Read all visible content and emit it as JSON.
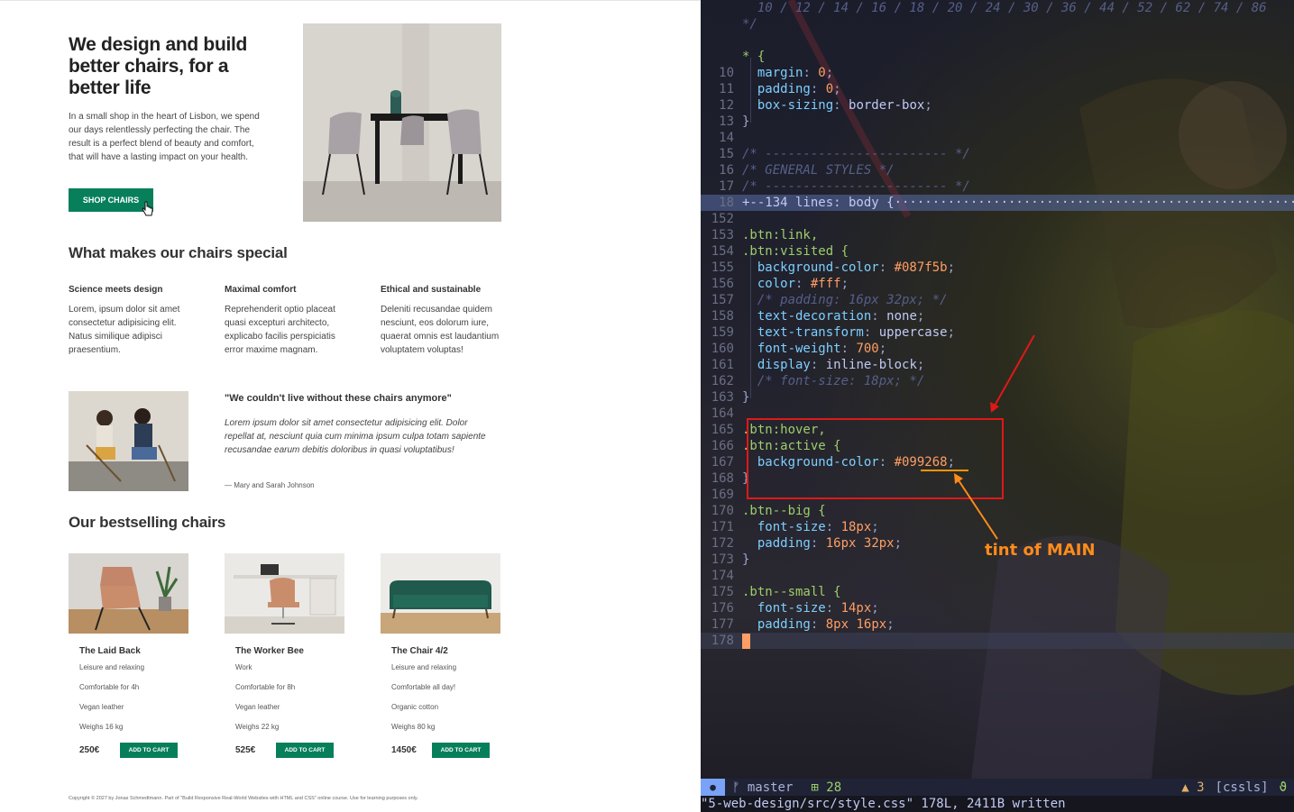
{
  "preview": {
    "hero": {
      "title": "We design and build better chairs, for a better life",
      "text": "In a small shop in the heart of Lisbon, we spend our days relentlessly perfecting the chair. The result is a perfect blend of beauty and comfort, that will have a lasting impact on your health.",
      "button_label": "SHOP CHAIRS"
    },
    "features": {
      "title": "What makes our chairs special",
      "items": [
        {
          "title": "Science meets design",
          "text": "Lorem, ipsum dolor sit amet consectetur adipisicing elit. Natus similique adipisci praesentium."
        },
        {
          "title": "Maximal comfort",
          "text": "Reprehenderit optio placeat quasi excepturi architecto, explicabo facilis perspiciatis error maxime magnam."
        },
        {
          "title": "Ethical and sustainable",
          "text": "Deleniti recusandae quidem nesciunt, eos dolorum iure, quaerat omnis est laudantium voluptatem voluptas!"
        }
      ]
    },
    "testimonial": {
      "quote_title": "\"We couldn't live without these chairs anymore\"",
      "text": "Lorem ipsum dolor sit amet consectetur adipisicing elit. Dolor repellat at, nesciunt quia cum minima ipsum culpa totam sapiente recusandae earum debitis doloribus in quasi voluptatibus!",
      "author": "— Mary and Sarah Johnson"
    },
    "products": {
      "title": "Our bestselling chairs",
      "cart_label": "ADD TO CART",
      "items": [
        {
          "name": "The Laid Back",
          "attrs": [
            "Leisure and relaxing",
            "Comfortable for 4h",
            "Vegan leather",
            "Weighs 16 kg"
          ],
          "price": "250€"
        },
        {
          "name": "The Worker Bee",
          "attrs": [
            "Work",
            "Comfortable for 8h",
            "Vegan leather",
            "Weighs 22 kg"
          ],
          "price": "525€"
        },
        {
          "name": "The Chair 4/2",
          "attrs": [
            "Leisure and relaxing",
            "Comfortable all day!",
            "Organic cotton",
            "Weighs 80 kg"
          ],
          "price": "1450€"
        }
      ]
    },
    "copyright": "Copyright © 2027 by Jonas Schmedtmann. Part of \"Build Responsive Real-World Websites with HTML and CSS\" online course. Use for learning purposes only."
  },
  "editor": {
    "lines": [
      {
        "n": "",
        "t": "  10 / 12 / 14 / 16 / 18 / 20 / 24 / 30 / 36 / 44 / 52 / 62 / 74 / 86",
        "k": "com"
      },
      {
        "n": "",
        "t": "*/",
        "k": "com"
      },
      {
        "n": "",
        "t": "",
        "k": ""
      },
      {
        "n": "",
        "t": "* {",
        "k": "sel"
      },
      {
        "n": "10",
        "t": "  margin: 0;",
        "k": "decl"
      },
      {
        "n": "11",
        "t": "  padding: 0;",
        "k": "decl"
      },
      {
        "n": "12",
        "t": "  box-sizing: border-box;",
        "k": "decl"
      },
      {
        "n": "13",
        "t": "}",
        "k": "punc"
      },
      {
        "n": "14",
        "t": "",
        "k": ""
      },
      {
        "n": "15",
        "t": "/* ------------------------ */",
        "k": "com"
      },
      {
        "n": "16",
        "t": "/* GENERAL STYLES */",
        "k": "com"
      },
      {
        "n": "17",
        "t": "/* ------------------------ */",
        "k": "com"
      },
      {
        "n": "18",
        "t": "+--134 lines: body {·······················································",
        "k": "fold"
      },
      {
        "n": "152",
        "t": "",
        "k": ""
      },
      {
        "n": "153",
        "t": ".btn:link,",
        "k": "sel"
      },
      {
        "n": "154",
        "t": ".btn:visited {",
        "k": "sel"
      },
      {
        "n": "155",
        "t": "  background-color: #087f5b;",
        "k": "decl"
      },
      {
        "n": "156",
        "t": "  color: #fff;",
        "k": "decl"
      },
      {
        "n": "157",
        "t": "  /* padding: 16px 32px; */",
        "k": "com"
      },
      {
        "n": "158",
        "t": "  text-decoration: none;",
        "k": "decl"
      },
      {
        "n": "159",
        "t": "  text-transform: uppercase;",
        "k": "decl"
      },
      {
        "n": "160",
        "t": "  font-weight: 700;",
        "k": "decl"
      },
      {
        "n": "161",
        "t": "  display: inline-block;",
        "k": "decl"
      },
      {
        "n": "162",
        "t": "  /* font-size: 18px; */",
        "k": "com"
      },
      {
        "n": "163",
        "t": "}",
        "k": "punc"
      },
      {
        "n": "164",
        "t": "",
        "k": ""
      },
      {
        "n": "165",
        "t": ".btn:hover,",
        "k": "sel"
      },
      {
        "n": "166",
        "t": ".btn:active {",
        "k": "sel"
      },
      {
        "n": "167",
        "t": "  background-color: #099268;",
        "k": "decl"
      },
      {
        "n": "168",
        "t": "}",
        "k": "punc"
      },
      {
        "n": "169",
        "t": "",
        "k": ""
      },
      {
        "n": "170",
        "t": ".btn--big {",
        "k": "sel"
      },
      {
        "n": "171",
        "t": "  font-size: 18px;",
        "k": "decl"
      },
      {
        "n": "172",
        "t": "  padding: 16px 32px;",
        "k": "decl"
      },
      {
        "n": "173",
        "t": "}",
        "k": "punc"
      },
      {
        "n": "174",
        "t": "",
        "k": ""
      },
      {
        "n": "175",
        "t": ".btn--small {",
        "k": "sel"
      },
      {
        "n": "176",
        "t": "  font-size: 14px;",
        "k": "decl"
      },
      {
        "n": "177",
        "t": "  padding: 8px 16px;",
        "k": "decl"
      },
      {
        "n": "178",
        "t": "",
        "k": "cursor"
      }
    ],
    "annotation": "tint of MAIN",
    "statusbar": {
      "mode_icon": "●",
      "branch": "master",
      "branch_icon": "ᚠ",
      "changes_icon": "⊞",
      "changes": "28",
      "warn_icon": "▲",
      "warnings": "3",
      "lsp": "[cssls]",
      "lsp_icon": "ϑ"
    },
    "cmdline": "\"5-web-design/src/style.css\" 178L, 2411B written"
  },
  "colors": {
    "accent": "#087f5b",
    "accent_tint": "#099268",
    "annotation_box": "#e01818",
    "annotation_text": "#ff8c1a"
  }
}
